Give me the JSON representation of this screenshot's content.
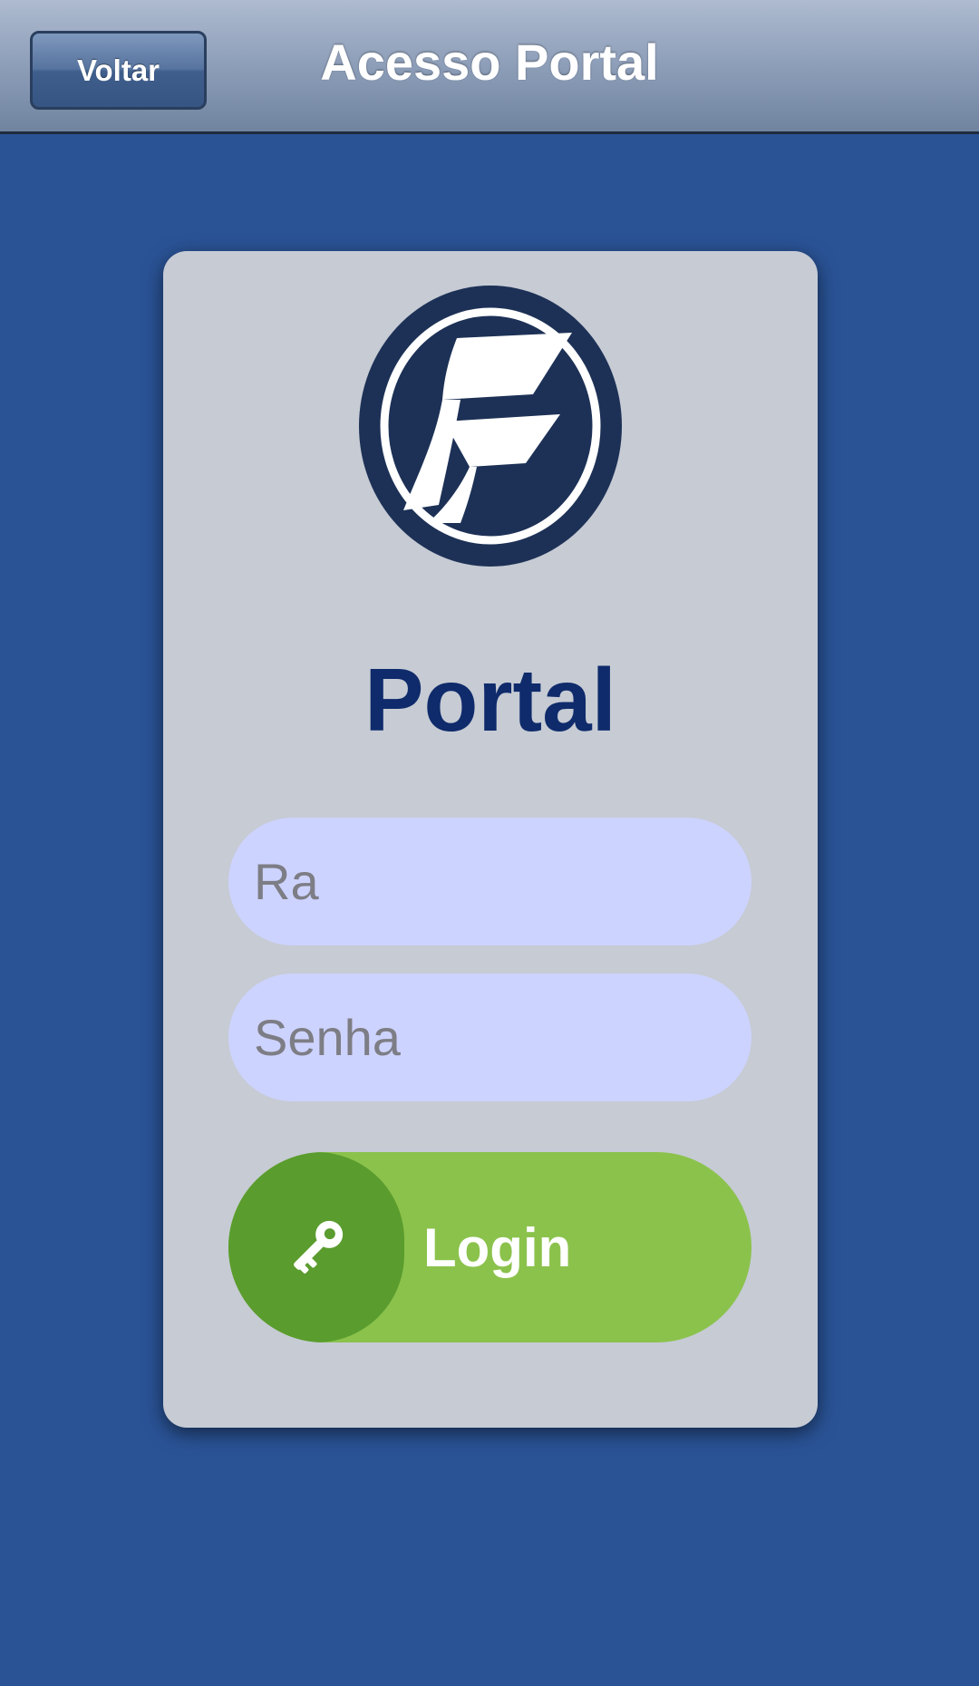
{
  "header": {
    "back_label": "Voltar",
    "title": "Acesso Portal"
  },
  "card": {
    "logo_icon": "portal-f-logo-icon",
    "title": "Portal",
    "ra_field": {
      "placeholder": "Ra",
      "value": ""
    },
    "password_field": {
      "placeholder": "Senha",
      "value": ""
    },
    "login_button": {
      "label": "Login",
      "icon": "key-icon"
    }
  },
  "colors": {
    "background": "#2a5396",
    "card": "#c6cbd4",
    "title": "#0f2b6b",
    "input": "#cdd3ff",
    "login": "#8bc24c",
    "login_icon_bg": "#5a9c2e",
    "logo_dark": "#1d3156"
  }
}
